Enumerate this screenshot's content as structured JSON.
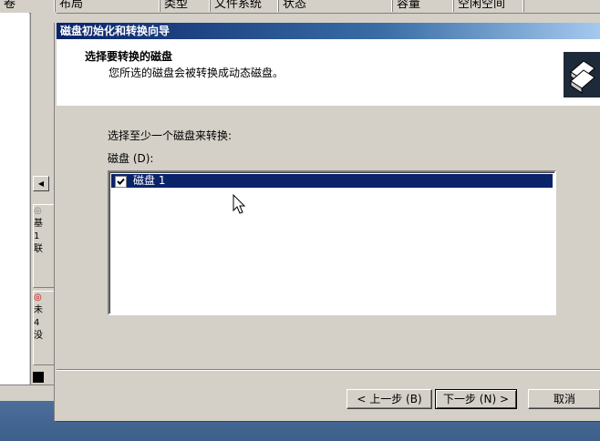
{
  "background_window": {
    "columns": [
      "卷",
      "布局",
      "类型",
      "文件系统",
      "状态",
      "容量",
      "空闲空间"
    ],
    "disk_panels": [
      {
        "lines": [
          "基",
          "1",
          "联"
        ]
      },
      {
        "lines": [
          "未",
          "4",
          "没"
        ]
      }
    ]
  },
  "dialog": {
    "title": "磁盘初始化和转换向导",
    "header": {
      "title": "选择要转换的磁盘",
      "subtitle": "您所选的磁盘会被转换成动态磁盘。"
    },
    "instruction": "选择至少一个磁盘来转换:",
    "disks_label": "磁盘 (D):",
    "disks": [
      {
        "name": "磁盘 1",
        "checked": true,
        "selected": true
      }
    ],
    "buttons": {
      "back": "< 上一步 (B)",
      "next": "下一步 (N) >",
      "cancel": "取消"
    }
  },
  "colors": {
    "selection": "#0a246a",
    "title_start": "#0a246a",
    "title_end": "#a6caf0",
    "face": "#d4d0c8",
    "taskbar": "#3d5f8a"
  }
}
